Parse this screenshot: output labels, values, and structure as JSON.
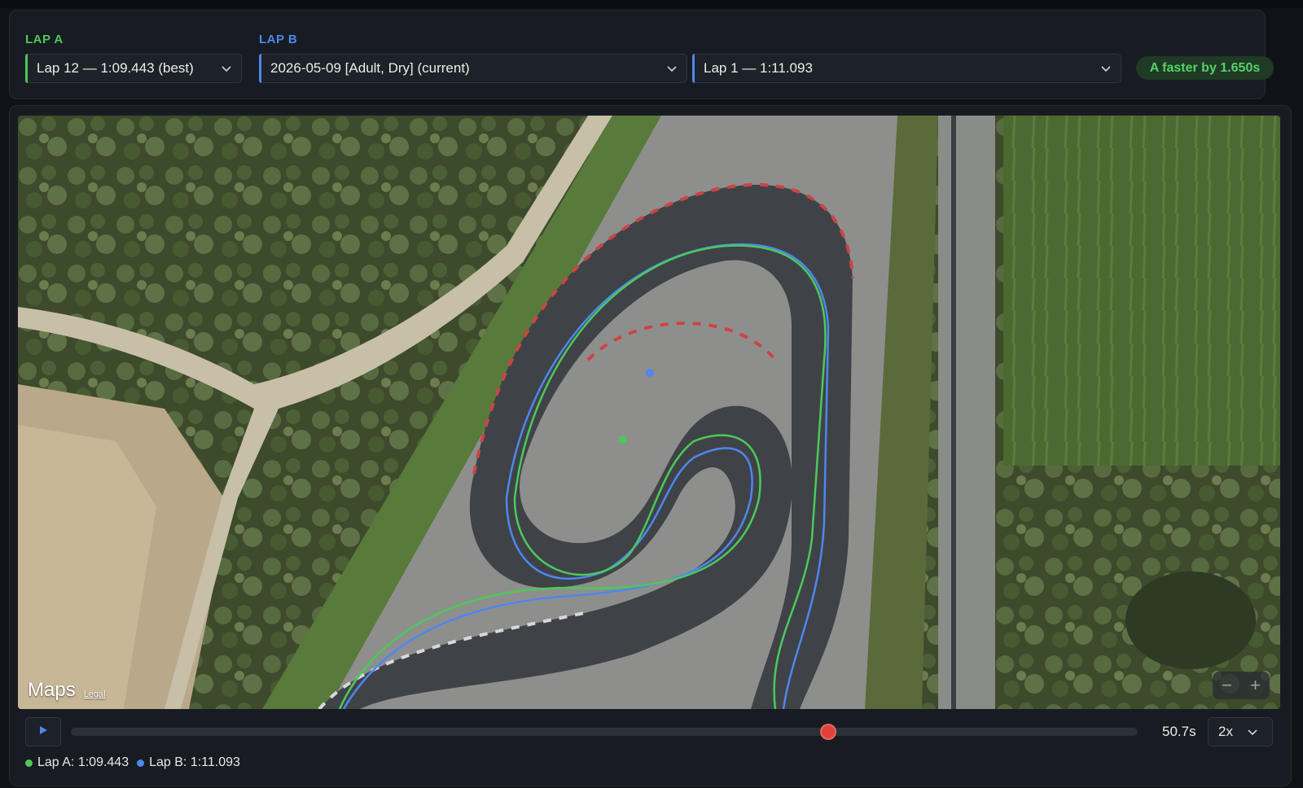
{
  "header": {
    "lap_a_label": "LAP A",
    "lap_b_label": "LAP B",
    "lap_a_select": "Lap 12 — 1:09.443 (best)",
    "session_select": "2026-05-09 [Adult, Dry] (current)",
    "lap_b_select": "Lap 1 — 1:11.093",
    "delta_badge": "A faster by 1.650s"
  },
  "map": {
    "provider_logo": "Maps",
    "legal_link": "Legal",
    "zoom_out": "−",
    "zoom_in": "+"
  },
  "playback": {
    "icon": "play-icon",
    "progress": 0.71,
    "time": "50.7s",
    "speed": "2x"
  },
  "legend": {
    "lap_a": "Lap A: 1:09.443",
    "lap_b": "Lap B: 1:11.093"
  },
  "colors": {
    "lap_a": "#4cc95a",
    "lap_b": "#4f86f0",
    "scrubber": "#e0413a"
  }
}
